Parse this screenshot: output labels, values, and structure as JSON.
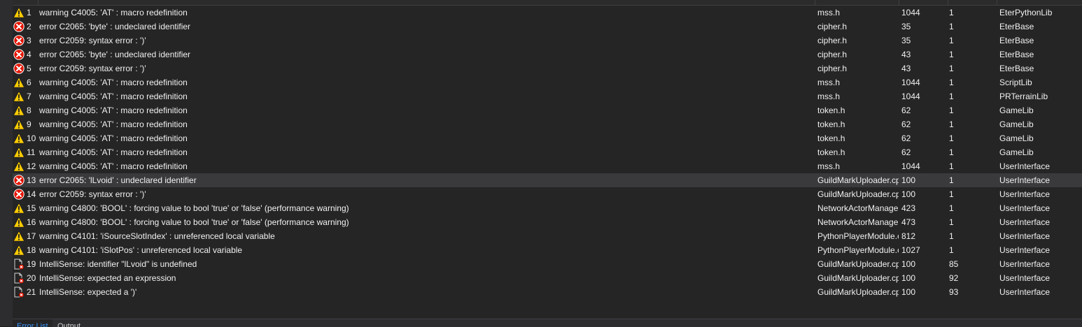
{
  "error_list": {
    "rows": [
      {
        "icon": "warning-icon",
        "num": "1",
        "desc": "warning C4005: 'AT' : macro redefinition",
        "file": "mss.h",
        "line": "1044",
        "col": "1",
        "project": "EterPythonLib"
      },
      {
        "icon": "error-icon",
        "num": "2",
        "desc": "error C2065: 'byte' : undeclared identifier",
        "file": "cipher.h",
        "line": "35",
        "col": "1",
        "project": "EterBase"
      },
      {
        "icon": "error-icon",
        "num": "3",
        "desc": "error C2059: syntax error : ')'",
        "file": "cipher.h",
        "line": "35",
        "col": "1",
        "project": "EterBase"
      },
      {
        "icon": "error-icon",
        "num": "4",
        "desc": "error C2065: 'byte' : undeclared identifier",
        "file": "cipher.h",
        "line": "43",
        "col": "1",
        "project": "EterBase"
      },
      {
        "icon": "error-icon",
        "num": "5",
        "desc": "error C2059: syntax error : ')'",
        "file": "cipher.h",
        "line": "43",
        "col": "1",
        "project": "EterBase"
      },
      {
        "icon": "warning-icon",
        "num": "6",
        "desc": "warning C4005: 'AT' : macro redefinition",
        "file": "mss.h",
        "line": "1044",
        "col": "1",
        "project": "ScriptLib"
      },
      {
        "icon": "warning-icon",
        "num": "7",
        "desc": "warning C4005: 'AT' : macro redefinition",
        "file": "mss.h",
        "line": "1044",
        "col": "1",
        "project": "PRTerrainLib"
      },
      {
        "icon": "warning-icon",
        "num": "8",
        "desc": "warning C4005: 'AT' : macro redefinition",
        "file": "token.h",
        "line": "62",
        "col": "1",
        "project": "GameLib"
      },
      {
        "icon": "warning-icon",
        "num": "9",
        "desc": "warning C4005: 'AT' : macro redefinition",
        "file": "token.h",
        "line": "62",
        "col": "1",
        "project": "GameLib"
      },
      {
        "icon": "warning-icon",
        "num": "10",
        "desc": "warning C4005: 'AT' : macro redefinition",
        "file": "token.h",
        "line": "62",
        "col": "1",
        "project": "GameLib"
      },
      {
        "icon": "warning-icon",
        "num": "11",
        "desc": "warning C4005: 'AT' : macro redefinition",
        "file": "token.h",
        "line": "62",
        "col": "1",
        "project": "GameLib"
      },
      {
        "icon": "warning-icon",
        "num": "12",
        "desc": "warning C4005: 'AT' : macro redefinition",
        "file": "mss.h",
        "line": "1044",
        "col": "1",
        "project": "UserInterface"
      },
      {
        "icon": "error-icon",
        "num": "13",
        "desc": "error C2065: 'lLvoid' : undeclared identifier",
        "file": "GuildMarkUploader.cpp",
        "line": "100",
        "col": "1",
        "project": "UserInterface",
        "selected": true
      },
      {
        "icon": "error-icon",
        "num": "14",
        "desc": "error C2059: syntax error : ')'",
        "file": "GuildMarkUploader.cpp",
        "line": "100",
        "col": "1",
        "project": "UserInterface"
      },
      {
        "icon": "warning-icon",
        "num": "15",
        "desc": "warning C4800: 'BOOL' : forcing value to bool 'true' or 'false' (performance warning)",
        "file": "NetworkActorManager.cpp",
        "line": "423",
        "col": "1",
        "project": "UserInterface"
      },
      {
        "icon": "warning-icon",
        "num": "16",
        "desc": "warning C4800: 'BOOL' : forcing value to bool 'true' or 'false' (performance warning)",
        "file": "NetworkActorManager.cpp",
        "line": "473",
        "col": "1",
        "project": "UserInterface"
      },
      {
        "icon": "warning-icon",
        "num": "17",
        "desc": "warning C4101: 'iSourceSlotIndex' : unreferenced local variable",
        "file": "PythonPlayerModule.cpp",
        "line": "812",
        "col": "1",
        "project": "UserInterface"
      },
      {
        "icon": "warning-icon",
        "num": "18",
        "desc": "warning C4101: 'iSlotPos' : unreferenced local variable",
        "file": "PythonPlayerModule.cpp",
        "line": "1027",
        "col": "1",
        "project": "UserInterface"
      },
      {
        "icon": "intellisense-error-icon",
        "num": "19",
        "desc": "IntelliSense: identifier \"lLvoid\" is undefined",
        "file": "GuildMarkUploader.cpp",
        "line": "100",
        "col": "85",
        "project": "UserInterface"
      },
      {
        "icon": "intellisense-error-icon",
        "num": "20",
        "desc": "IntelliSense: expected an expression",
        "file": "GuildMarkUploader.cpp",
        "line": "100",
        "col": "92",
        "project": "UserInterface"
      },
      {
        "icon": "intellisense-error-icon",
        "num": "21",
        "desc": "IntelliSense: expected a ')'",
        "file": "GuildMarkUploader.cpp",
        "line": "100",
        "col": "93",
        "project": "UserInterface"
      }
    ]
  },
  "tabs": [
    {
      "label": "Error List",
      "active": true
    },
    {
      "label": "Output",
      "active": false
    }
  ],
  "colors": {
    "background": "#252526",
    "selected_row": "#3a3a3d",
    "error_red": "#e51400",
    "warning_yellow": "#ffcc00",
    "active_tab": "#3794ff"
  }
}
